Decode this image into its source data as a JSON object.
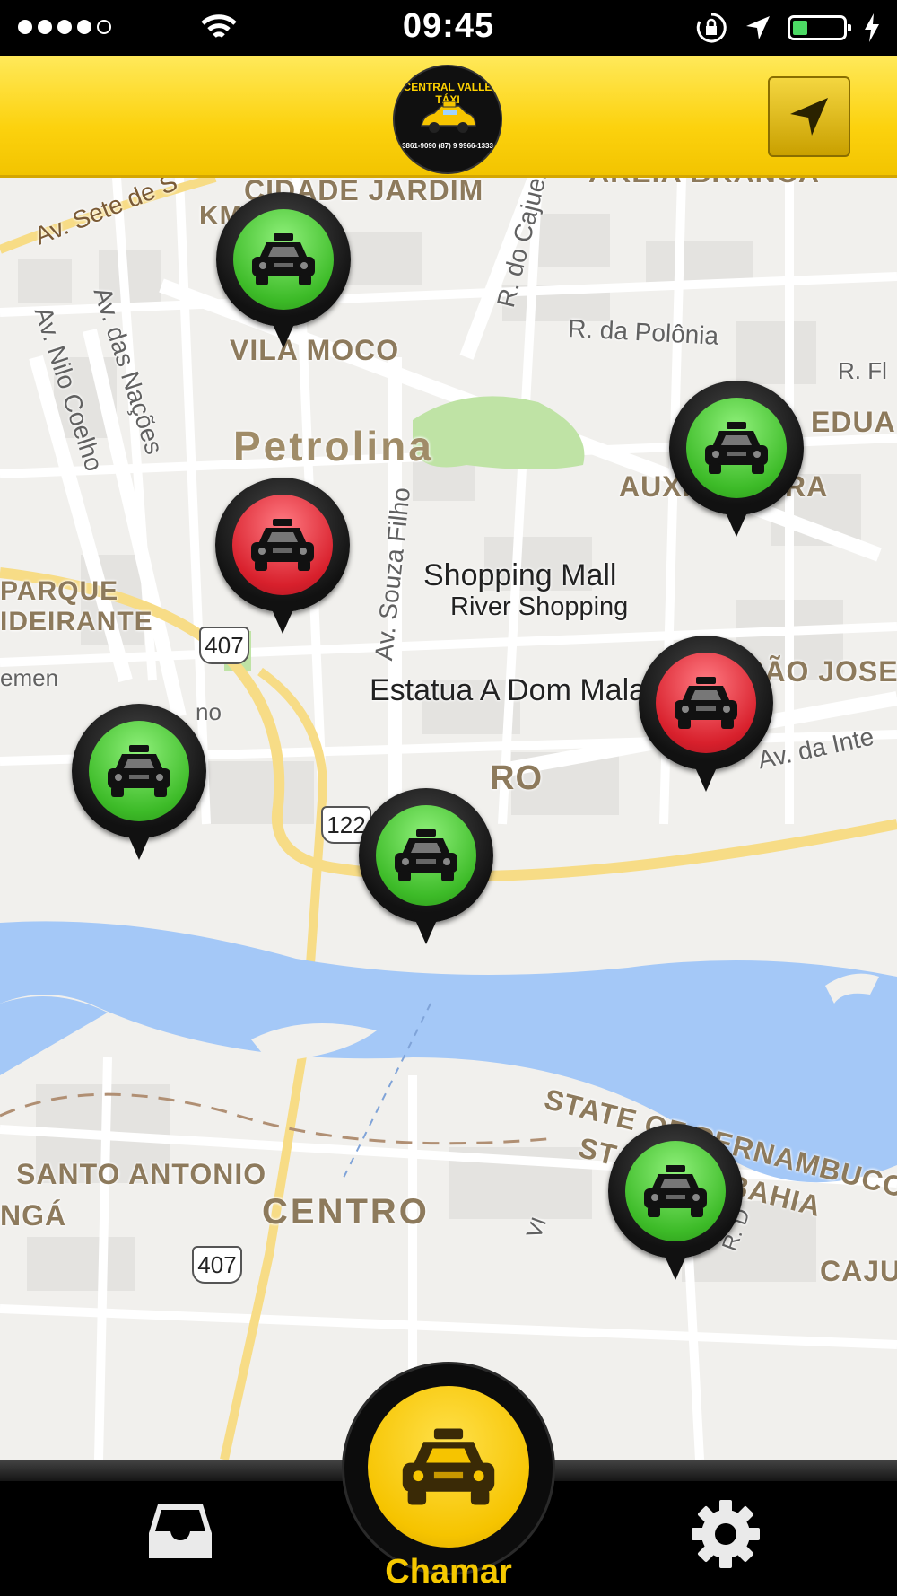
{
  "status_bar": {
    "time": "09:45",
    "signal_dots_filled": 4,
    "signal_dots_total": 5,
    "battery_level": 0.3,
    "icons": [
      "wifi-icon",
      "orientation-lock-icon",
      "location-arrow-icon",
      "battery-icon",
      "charging-bolt-icon"
    ]
  },
  "header": {
    "logo": {
      "line1": "CENTRAL VALLE TÁXI",
      "line2": "3861-9090 (87) 9 9966-1333"
    },
    "locate_icon": "navigation-arrow-icon",
    "accent_color": "#fcd20e"
  },
  "map": {
    "neighborhoods": {
      "cidade_jardim": "CIDADE JARDIM",
      "areia_branca": "AREIA BRANCA",
      "vila_moco": "VILA MOCO",
      "petrolina": "Petrolina",
      "auxiliadora": "AUXILIADORA",
      "parque": "PARQUE",
      "ideirante": "IDEIRANTE",
      "sao_jose": "SÃO JOSE",
      "santo_antonio": "SANTO ANTONIO",
      "centro": "CENTRO",
      "nga": "NGÁ",
      "caju": "CAJU",
      "eduard": "EDUA",
      "km": "KM",
      "ro": "RO",
      "state_pe": "STATE OF PERNAMBUCO",
      "state_ba": "STATE OF BAHIA"
    },
    "streets": {
      "sete": "Av. Sete de S",
      "cajueiro": "R. do Cajueiro",
      "polonia": "R. da Polônia",
      "nacoes": "Av. das Nações",
      "nilo": "Av. Nilo Coelho",
      "souza": "Av. Souza Filho",
      "inter": "Av. da Inte",
      "rfl": "R. Fl",
      "clemen": "emen",
      "no": "no",
      "rd": "R. D",
      "vi": "VI"
    },
    "pois": {
      "mall": "Shopping Mall",
      "river": "River Shopping",
      "statue": "Estatua A Dom Malan"
    },
    "route_shields": [
      "407",
      "122",
      "407"
    ],
    "taxis": [
      {
        "status": "available",
        "color": "green"
      },
      {
        "status": "available",
        "color": "green"
      },
      {
        "status": "busy",
        "color": "red"
      },
      {
        "status": "busy",
        "color": "red"
      },
      {
        "status": "available",
        "color": "green"
      },
      {
        "status": "available",
        "color": "green"
      },
      {
        "status": "available",
        "color": "green"
      }
    ]
  },
  "tab_bar": {
    "call_label": "Chamar",
    "left_icon": "inbox-icon",
    "right_icon": "gear-icon",
    "center_icon": "taxi-icon"
  }
}
